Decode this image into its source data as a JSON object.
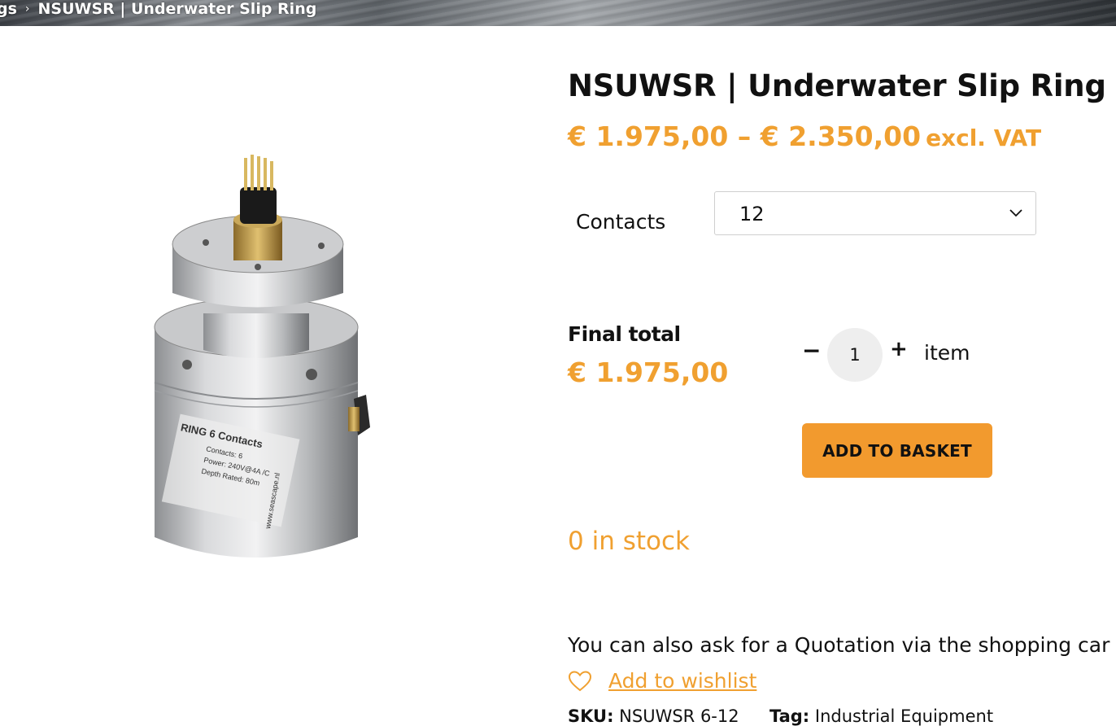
{
  "breadcrumb": {
    "prev": "gs",
    "separator": "›",
    "current": "NSUWSR | Underwater Slip Ring"
  },
  "product": {
    "title": "NSUWSR | Underwater Slip Ring",
    "price_range": "€ 1.975,00 – € 2.350,00",
    "vat_note": "excl. VAT",
    "image_label_lines": [
      "RING 6 Contacts",
      "Contacts: 6",
      "Power: 240V@4A /C",
      "Depth Rated: 80m",
      "www.seascape.nl"
    ]
  },
  "options": {
    "contacts_label": "Contacts",
    "contacts_value": "12"
  },
  "total": {
    "label": "Final total",
    "value": "€ 1.975,00"
  },
  "quantity": {
    "minus": "−",
    "value": "1",
    "plus": "+",
    "unit": "item"
  },
  "add_to_basket": "ADD TO BASKET",
  "stock": "0 in stock",
  "quote_text": "You can also ask for a Quotation via the shopping car",
  "wishlist": {
    "icon": "heart-icon",
    "label": " Add to wishlist"
  },
  "meta": {
    "sku_label": "SKU:",
    "sku_value": "NSUWSR 6-12",
    "tag_label": "Tag:",
    "tag_value": "Industrial Equipment"
  },
  "colors": {
    "accent": "#f0a030",
    "button": "#f29a2e"
  }
}
